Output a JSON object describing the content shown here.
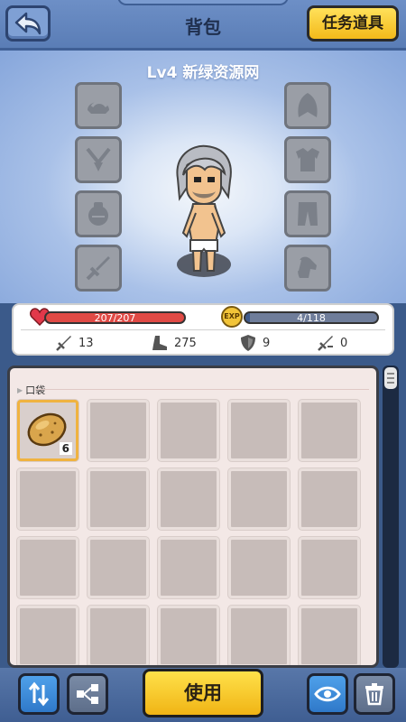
{
  "header": {
    "title": "背包",
    "task_button": "任务道具"
  },
  "character": {
    "title": "Lv4 新绿资源网"
  },
  "equipment_slots_left": [
    "helmet-slot-icon",
    "amulet-slot-icon",
    "bag-slot-icon",
    "sword-slot-icon"
  ],
  "equipment_slots_right": [
    "cloak-slot-icon",
    "armor-slot-icon",
    "pants-slot-icon",
    "pet-slot-icon"
  ],
  "stats": {
    "hp_text": "207/207",
    "hp_fraction": 1.0,
    "exp_badge": "EXP",
    "exp_text": "4/118",
    "exp_fraction": 0.034,
    "attack": "13",
    "speed": "275",
    "defense": "9",
    "crit": "0"
  },
  "inventory": {
    "label": "口袋",
    "items": [
      {
        "name": "potato",
        "count": "6"
      }
    ],
    "rows": 4,
    "cols": 5
  },
  "bottom": {
    "use_button": "使用"
  },
  "colors": {
    "hp": "#e04a45",
    "exp": "#6f7d9a",
    "accent": "#f3b91a",
    "selected": "#f0b340"
  }
}
